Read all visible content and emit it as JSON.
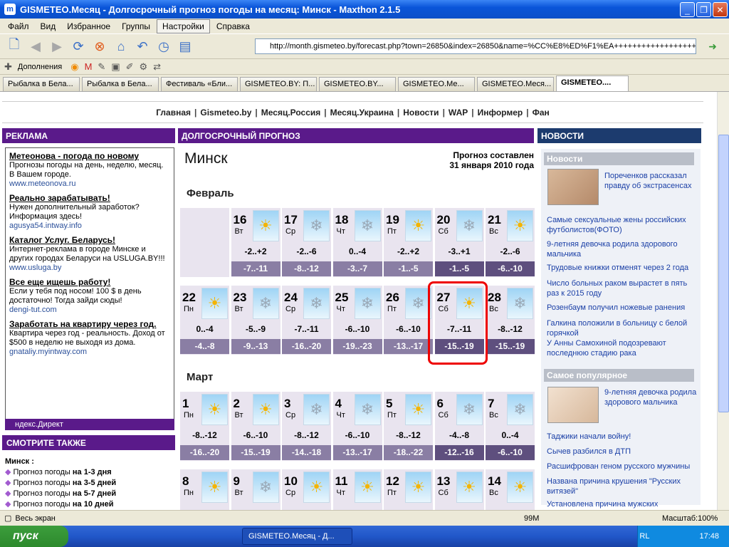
{
  "window": {
    "title": "GISMETEO.Месяц - Долгосрочный прогноз погоды на месяц: Минск - Maxthon 2.1.5"
  },
  "menu": [
    "Файл",
    "Вид",
    "Избранное",
    "Группы",
    "Настройки",
    "Справка"
  ],
  "address": "http://month.gismeteo.by/forecast.php?town=26850&index=26850&name=%CC%E8%ED%F1%EA++++++++++++++++++",
  "plugins": {
    "label": "Дополнения"
  },
  "tabs": [
    "Рыбалка в Бела...",
    "Рыбалка в Бела...",
    "Фестиваль «Бли...",
    "GISMETEO.BY: П...",
    "GISMETEO.BY...",
    "GISMETEO.Ме...",
    "GISMETEO.Меся...",
    "GISMETEO...."
  ],
  "nav": [
    "Главная",
    "Gismeteo.by",
    "Месяц.Россия",
    "Месяц.Украина",
    "Новости",
    "WAP",
    "Информер",
    "Фан"
  ],
  "ads_head": "РЕКЛАМА",
  "ads": [
    {
      "t": "Метеонова - погода по новому",
      "d": "Прогнозы погоды на день, неделю, месяц. В Вашем городе.",
      "u": "www.meteonova.ru"
    },
    {
      "t": "Реально зарабатывать!",
      "d": "Нужен дополнительный заработок? Информация здесь!",
      "u": "agusya54.intway.info"
    },
    {
      "t": "Каталог Услуг. Беларусь!",
      "d": "Интернет-реклама в городе Минске и других городах Беларуси на USLUGA.BY!!!",
      "u": "www.usluga.by"
    },
    {
      "t": "Все еще ищешь работу!",
      "d": "Если у тебя под носом! 100 $ в день достаточно! Тогда зайди сюды!",
      "u": "dengi-tut.com"
    },
    {
      "t": "Заработать на квартиру через год.",
      "d": "Квартира через год - реальность. Доход от $500 в неделю не выходя из дома.",
      "u": "gnataliy.myintway.com"
    }
  ],
  "yandex": "ндекс.Директ",
  "also_head": "СМОТРИТЕ ТАКЖЕ",
  "minsk_label": "Минск :",
  "minsk_links": [
    {
      "a": "Прогноз погоды ",
      "b": "на 1-3 дня"
    },
    {
      "a": "Прогноз погоды ",
      "b": "на 3-5 дней"
    },
    {
      "a": "Прогноз погоды ",
      "b": "на 5-7 дней"
    },
    {
      "a": "Прогноз погоды ",
      "b": "на 10 дней"
    }
  ],
  "forecast_head": "ДОЛГОСРОЧНЫЙ ПРОГНОЗ",
  "city": "Минск",
  "made_line1": "Прогноз составлен",
  "made_line2": "31 января 2010 года",
  "month1": "Февраль",
  "month2": "Март",
  "feb_row1": [
    {
      "n": "16",
      "w": "Вт",
      "i": "sun",
      "d": "-2..+2",
      "nt": "-7..-11"
    },
    {
      "n": "17",
      "w": "Ср",
      "i": "snow",
      "d": "-2..-6",
      "nt": "-8..-12"
    },
    {
      "n": "18",
      "w": "Чт",
      "i": "snow",
      "d": "0..-4",
      "nt": "-3..-7"
    },
    {
      "n": "19",
      "w": "Пт",
      "i": "sun",
      "d": "-2..+2",
      "nt": "-1..-5"
    },
    {
      "n": "20",
      "w": "Сб",
      "i": "snow",
      "d": "-3..+1",
      "nt": "-1..-5"
    },
    {
      "n": "21",
      "w": "Вс",
      "i": "sun",
      "d": "-2..-6",
      "nt": "-6..-10"
    }
  ],
  "feb_row2": [
    {
      "n": "22",
      "w": "Пн",
      "i": "sun",
      "d": "0..-4",
      "nt": "-4..-8"
    },
    {
      "n": "23",
      "w": "Вт",
      "i": "snow",
      "d": "-5..-9",
      "nt": "-9..-13"
    },
    {
      "n": "24",
      "w": "Ср",
      "i": "snow",
      "d": "-7..-11",
      "nt": "-16..-20"
    },
    {
      "n": "25",
      "w": "Чт",
      "i": "snow",
      "d": "-6..-10",
      "nt": "-19..-23"
    },
    {
      "n": "26",
      "w": "Пт",
      "i": "snow",
      "d": "-6..-10",
      "nt": "-13..-17"
    },
    {
      "n": "27",
      "w": "Сб",
      "i": "sun",
      "d": "-7..-11",
      "nt": "-15..-19"
    },
    {
      "n": "28",
      "w": "Вс",
      "i": "snow",
      "d": "-8..-12",
      "nt": "-15..-19"
    }
  ],
  "mar_row1": [
    {
      "n": "1",
      "w": "Пн",
      "i": "sun",
      "d": "-8..-12",
      "nt": "-16..-20"
    },
    {
      "n": "2",
      "w": "Вт",
      "i": "sun",
      "d": "-6..-10",
      "nt": "-15..-19"
    },
    {
      "n": "3",
      "w": "Ср",
      "i": "snow",
      "d": "-8..-12",
      "nt": "-14..-18"
    },
    {
      "n": "4",
      "w": "Чт",
      "i": "snow",
      "d": "-6..-10",
      "nt": "-13..-17"
    },
    {
      "n": "5",
      "w": "Пт",
      "i": "sun",
      "d": "-8..-12",
      "nt": "-18..-22"
    },
    {
      "n": "6",
      "w": "Сб",
      "i": "snow",
      "d": "-4..-8",
      "nt": "-12..-16"
    },
    {
      "n": "7",
      "w": "Вс",
      "i": "snow",
      "d": "0..-4",
      "nt": "-6..-10"
    }
  ],
  "mar_row2": [
    {
      "n": "8",
      "w": "Пн",
      "i": "sun"
    },
    {
      "n": "9",
      "w": "Вт",
      "i": "snow"
    },
    {
      "n": "10",
      "w": "Ср",
      "i": "sun"
    },
    {
      "n": "11",
      "w": "Чт",
      "i": "sun"
    },
    {
      "n": "12",
      "w": "Пт",
      "i": "sun"
    },
    {
      "n": "13",
      "w": "Сб",
      "i": "sun"
    },
    {
      "n": "14",
      "w": "Вс",
      "i": "sun"
    }
  ],
  "news_head": "НОВОСТИ",
  "news_sub": "Новости",
  "news_feature": "Пореченков рассказал правду об экстрасенсах",
  "news": [
    "Самые сексуальные жены российских футболистов(ФОТО)",
    "9-летняя девочка родила здорового мальчика",
    "Трудовые книжки отменят через 2 года",
    "Число больных раком вырастет в пять раз к 2015 году",
    "Розенбаум получил ножевые ранения",
    "Галкина положили в больницу с белой горячкой",
    "У Анны Самохиной подозревают последнюю стадию рака"
  ],
  "popular_head": "Самое популярное",
  "popular_feature": "9-летняя девочка родила здорового мальчика",
  "popular": [
    "Таджики начали войну!",
    "Сычев разбился в ДТП",
    "Расшифрован геном русского мужчины",
    "Названа причина крушения \"Русских витязей\"",
    "Установлена причина мужских"
  ],
  "status": {
    "left": "Весь экран",
    "mem": "99M",
    "zoom": "Масштаб:100%"
  },
  "taskbar": {
    "start": "пуск",
    "task": "GISMETEO.Месяц - Д...",
    "lang": "RL",
    "time": "17:48"
  }
}
